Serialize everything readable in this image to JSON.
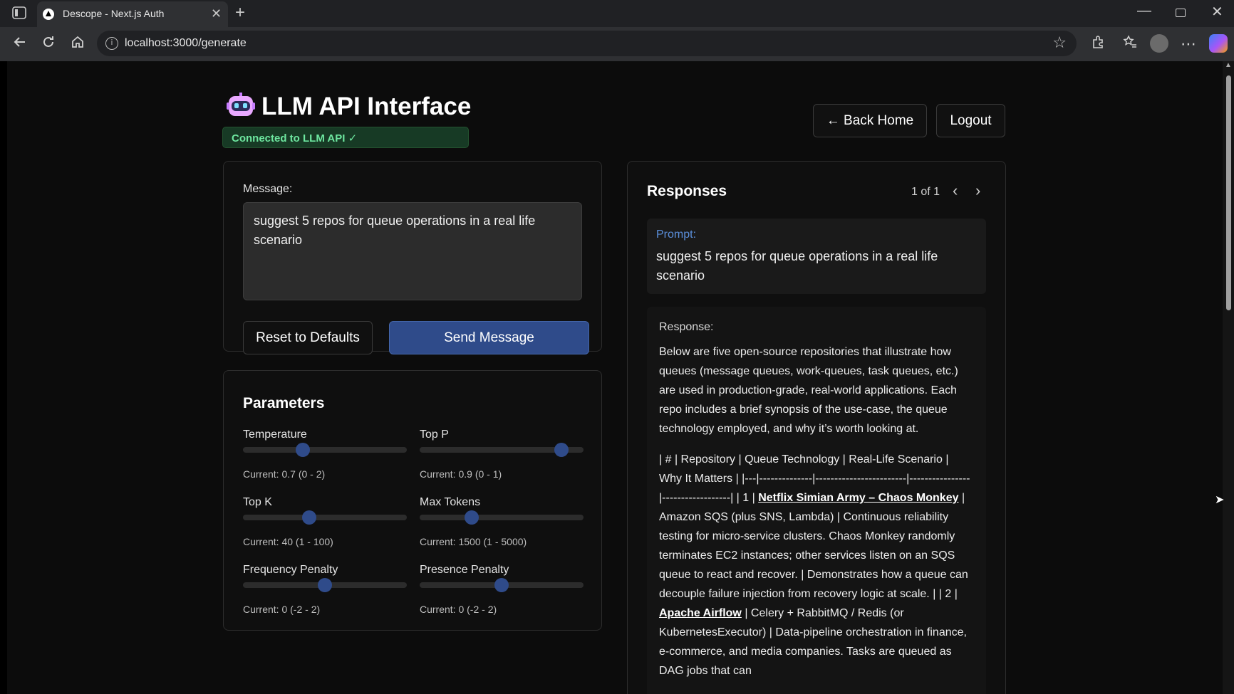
{
  "browser": {
    "tab_title": "Descope - Next.js Auth",
    "tab_close": "✕",
    "new_tab": "+",
    "url": "localhost:3000/generate",
    "win_min": "—",
    "win_close": "✕"
  },
  "header": {
    "title": "LLM API Interface",
    "status": "Connected to LLM API ✓",
    "back_button": "← Back Home",
    "logout_button": "Logout"
  },
  "message": {
    "label": "Message:",
    "value": "suggest 5 repos for queue operations in a real life scenario",
    "reset_button": "Reset to Defaults",
    "send_button": "Send Message"
  },
  "parameters": {
    "title": "Parameters",
    "items": [
      {
        "label": "Temperature",
        "current": "Current: 0.7 (0 - 2)",
        "value": 0.7,
        "min": 0,
        "max": 2
      },
      {
        "label": "Top P",
        "current": "Current: 0.9 (0 - 1)",
        "value": 0.9,
        "min": 0,
        "max": 1
      },
      {
        "label": "Top K",
        "current": "Current: 40 (1 - 100)",
        "value": 40,
        "min": 1,
        "max": 100
      },
      {
        "label": "Max Tokens",
        "current": "Current: 1500 (1 - 5000)",
        "value": 1500,
        "min": 1,
        "max": 5000
      },
      {
        "label": "Frequency Penalty",
        "current": "Current: 0 (-2 - 2)",
        "value": 0,
        "min": -2,
        "max": 2
      },
      {
        "label": "Presence Penalty",
        "current": "Current: 0 (-2 - 2)",
        "value": 0,
        "min": -2,
        "max": 2
      }
    ]
  },
  "responses": {
    "title": "Responses",
    "count": "1 of 1",
    "prompt_label": "Prompt:",
    "prompt_text": "suggest 5 repos for queue operations in a real life scenario",
    "response_label": "Response:",
    "intro": "Below are five open-source repositories that illustrate how queues (message queues, work-queues, task queues, etc.) are used in production-grade, real-world applications. Each repo includes a brief synopsis of the use-case, the queue technology employed, and why it’s worth looking at.",
    "table_header": "| # | Repository | Queue Technology | Real-Life Scenario | Why It Matters | |---|--------------|------------------------|----------------|------------------| | 1 |",
    "link_1": "Netflix Simian Army – Chaos Monkey",
    "after_link_1": "| Amazon SQS (plus SNS, Lambda) | Continuous reliability testing for micro-service clusters. Chaos Monkey randomly terminates EC2 instances; other services listen on an SQS queue to react and recover. | Demonstrates how a queue can decouple failure injection from recovery logic at scale. | | 2 |",
    "link_2": "Apache Airflow",
    "after_link_2": "| Celery + RabbitMQ / Redis (or KubernetesExecutor) | Data-pipeline orchestration in finance, e-commerce, and media companies. Tasks are queued as DAG jobs that can"
  }
}
